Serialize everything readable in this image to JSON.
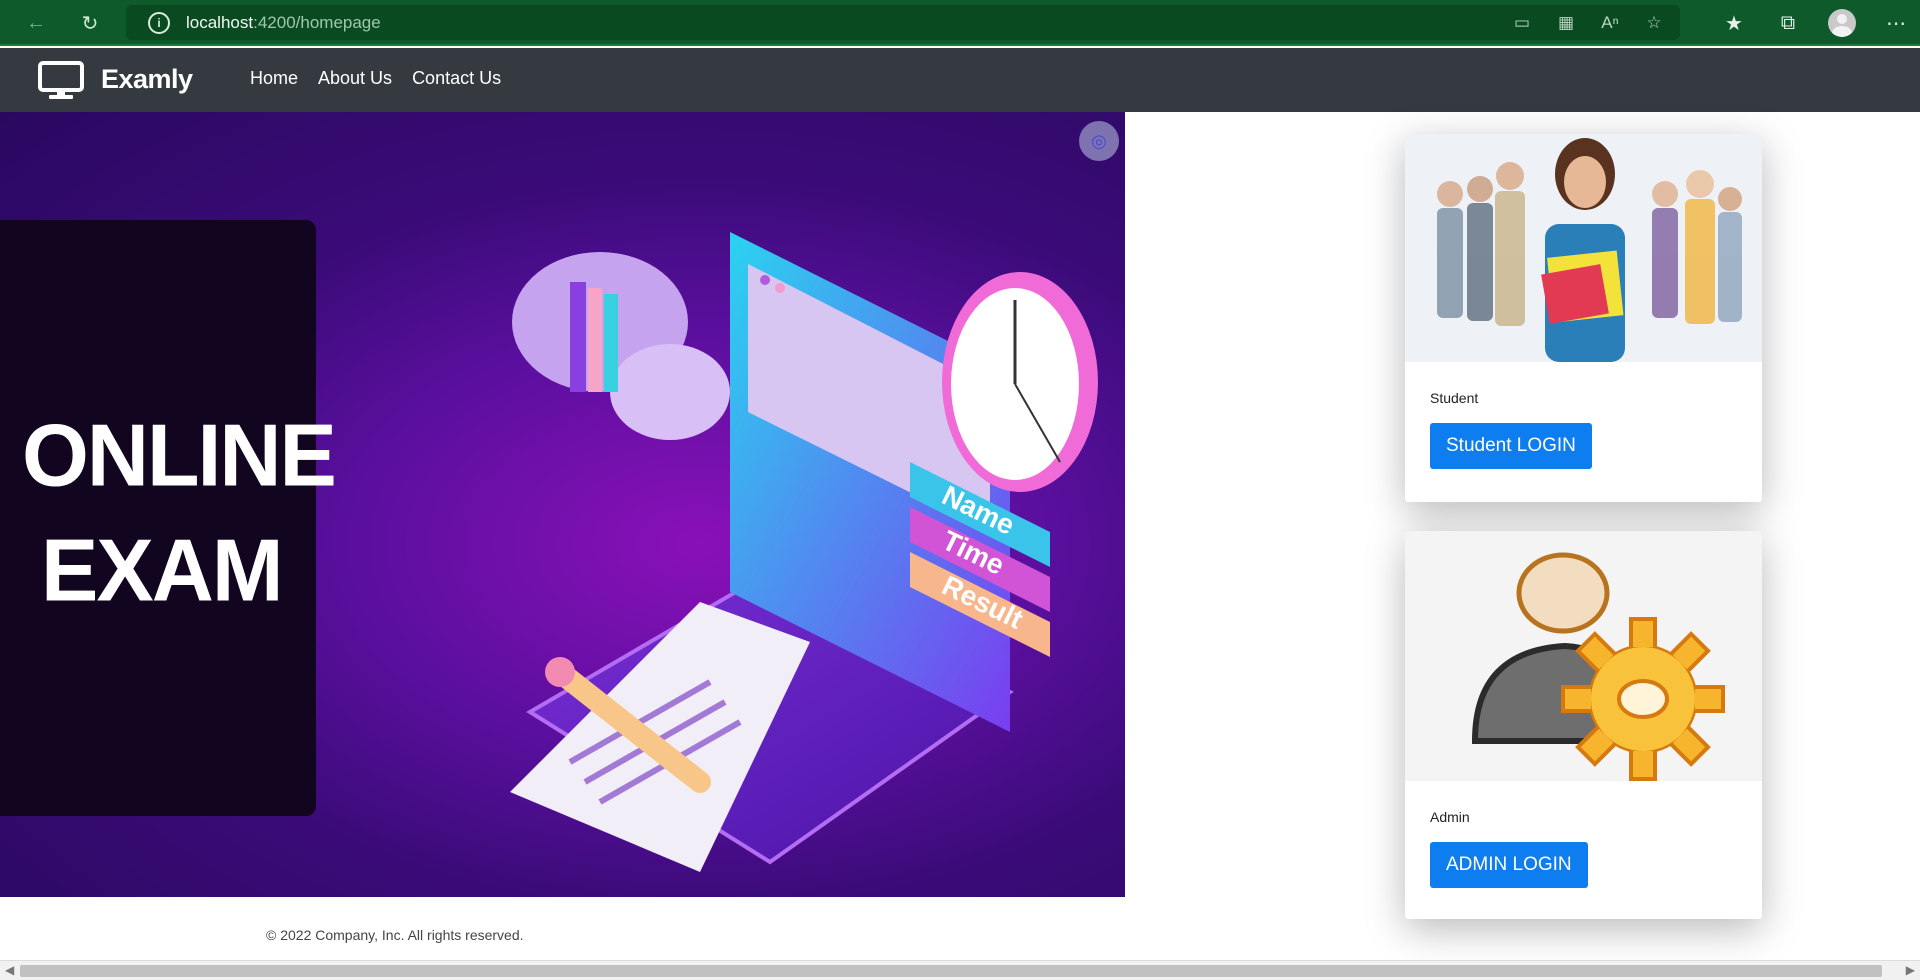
{
  "browser": {
    "url_host": "localhost",
    "url_path": ":4200/homepage",
    "icons": [
      "back-arrow-icon",
      "reload-icon",
      "info-icon",
      "app-available-icon",
      "extensions-icon",
      "read-aloud-icon",
      "add-favorite-icon",
      "favorites-icon",
      "collections-icon",
      "profile-icon",
      "more-icon"
    ]
  },
  "navbar": {
    "brand": "Examly",
    "links": [
      "Home",
      "About Us",
      "Contact Us"
    ]
  },
  "hero": {
    "title_line1": "ONLINE",
    "title_line2": "EXAM",
    "illustration_labels": [
      "Name",
      "Time",
      "Result"
    ]
  },
  "cards": {
    "student": {
      "label": "Student",
      "button": "Student LOGIN"
    },
    "admin": {
      "label": "Admin",
      "button": "ADMIN LOGIN"
    }
  },
  "footer": {
    "text": "© 2022 Company, Inc. All rights reserved."
  },
  "colors": {
    "browser_bar": "#0f5a2a",
    "navbar": "#343a40",
    "button": "#0d7df0",
    "hero": "#4a0c8c"
  }
}
